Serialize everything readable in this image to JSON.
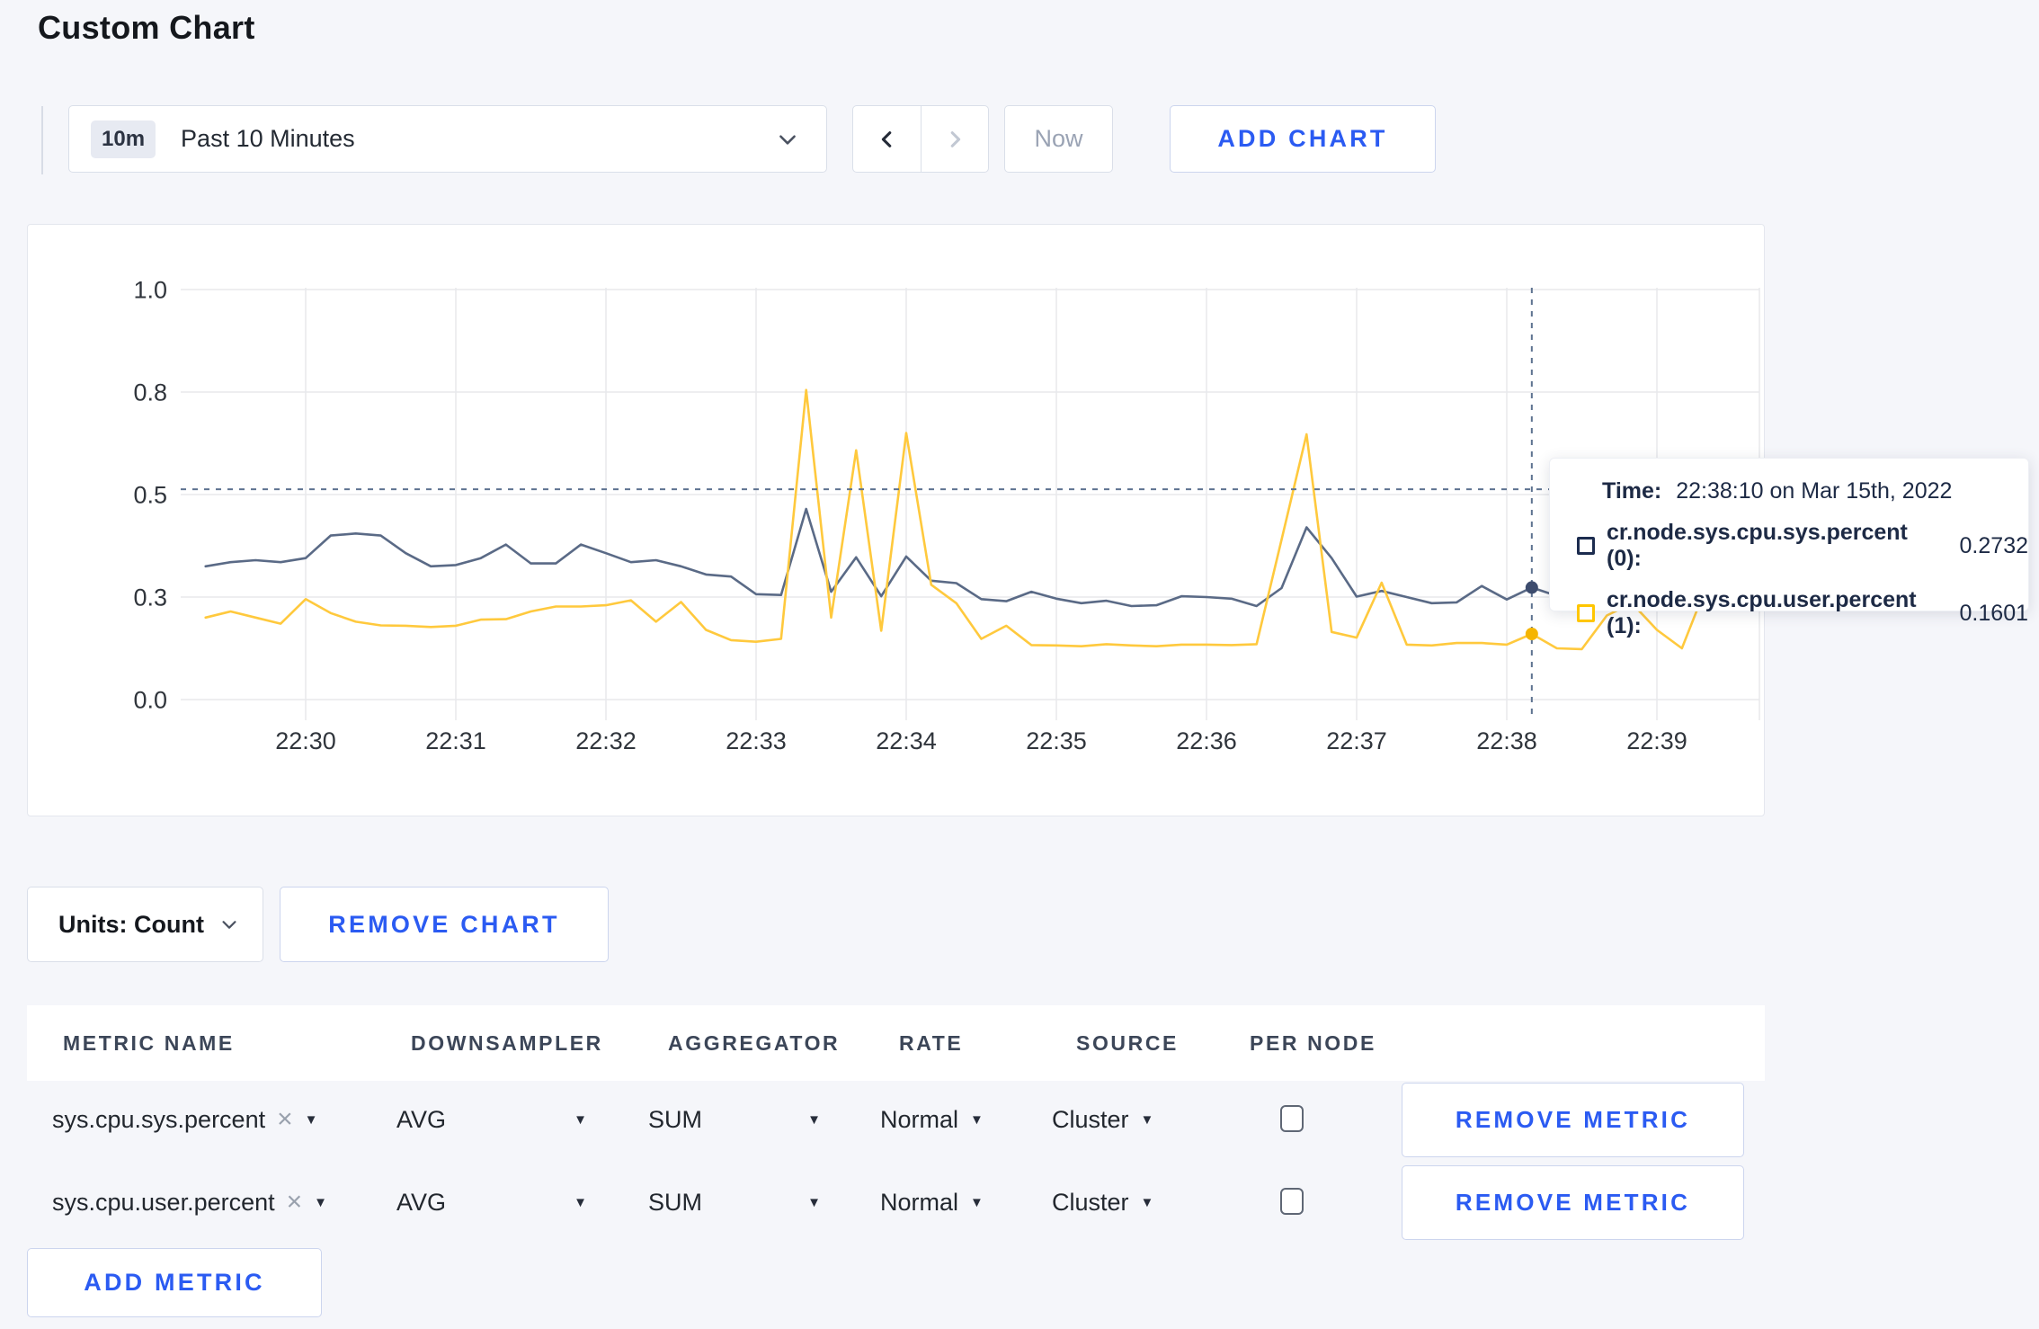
{
  "page": {
    "title": "Custom Chart"
  },
  "toolbar": {
    "time_badge": "10m",
    "time_label": "Past 10 Minutes",
    "now_label": "Now",
    "add_chart_label": "ADD CHART"
  },
  "chart_data": {
    "type": "line",
    "title": "",
    "xlabel": "",
    "ylabel": "",
    "ylim": [
      0,
      1
    ],
    "grid": true,
    "legend_position": "tooltip",
    "y_ticks": [
      {
        "v": 0.0,
        "label": "0.0"
      },
      {
        "v": 0.25,
        "label": "0.3"
      },
      {
        "v": 0.5,
        "label": "0.5"
      },
      {
        "v": 0.75,
        "label": "0.8"
      },
      {
        "v": 1.0,
        "label": "1.0"
      }
    ],
    "x_ticks": [
      "22:30",
      "22:31",
      "22:32",
      "22:33",
      "22:34",
      "22:35",
      "22:36",
      "22:37",
      "22:38",
      "22:39"
    ],
    "start_time": "22:29:20",
    "step_seconds": 10,
    "crosshair": {
      "time": "22:38:10",
      "hline_value": 0.513
    },
    "series": [
      {
        "name": "cr.node.sys.cpu.sys.percent",
        "color": "#5a6a86",
        "marker_color": "#3d4c6e",
        "values": [
          0.325,
          0.335,
          0.34,
          0.335,
          0.345,
          0.4,
          0.405,
          0.4,
          0.357,
          0.325,
          0.328,
          0.345,
          0.378,
          0.332,
          0.332,
          0.378,
          0.357,
          0.335,
          0.34,
          0.325,
          0.305,
          0.3,
          0.257,
          0.255,
          0.465,
          0.263,
          0.347,
          0.252,
          0.349,
          0.29,
          0.284,
          0.245,
          0.24,
          0.263,
          0.246,
          0.235,
          0.241,
          0.228,
          0.23,
          0.252,
          0.25,
          0.246,
          0.228,
          0.272,
          0.42,
          0.345,
          0.251,
          0.265,
          0.25,
          0.235,
          0.237,
          0.277,
          0.244,
          0.2732,
          0.253,
          0.245,
          0.26,
          0.3,
          0.295,
          0.29,
          0.3
        ]
      },
      {
        "name": "cr.node.sys.cpu.user.percent",
        "color": "#ffc93d",
        "marker_color": "#f5b500",
        "values": [
          0.2,
          0.215,
          0.2,
          0.185,
          0.245,
          0.211,
          0.19,
          0.181,
          0.18,
          0.177,
          0.18,
          0.195,
          0.196,
          0.215,
          0.227,
          0.227,
          0.23,
          0.242,
          0.19,
          0.238,
          0.17,
          0.145,
          0.141,
          0.148,
          0.755,
          0.2,
          0.608,
          0.168,
          0.65,
          0.28,
          0.235,
          0.148,
          0.18,
          0.133,
          0.132,
          0.13,
          0.135,
          0.132,
          0.13,
          0.134,
          0.134,
          0.133,
          0.135,
          0.39,
          0.647,
          0.165,
          0.151,
          0.285,
          0.134,
          0.132,
          0.138,
          0.138,
          0.134,
          0.1601,
          0.125,
          0.123,
          0.205,
          0.235,
          0.17,
          0.125,
          0.28
        ]
      }
    ]
  },
  "tooltip": {
    "time_label": "Time:",
    "time_value": "22:38:10 on Mar 15th, 2022",
    "rows": [
      {
        "name": "cr.node.sys.cpu.sys.percent (0):",
        "value": "0.2732",
        "color": "#1c2c4f"
      },
      {
        "name": "cr.node.sys.cpu.user.percent (1):",
        "value": "0.1601",
        "color": "#ffc600"
      }
    ]
  },
  "chart_controls": {
    "units_label": "Units: Count",
    "remove_chart_label": "REMOVE CHART"
  },
  "metrics_table": {
    "headers": [
      "METRIC NAME",
      "DOWNSAMPLER",
      "AGGREGATOR",
      "RATE",
      "SOURCE",
      "PER NODE"
    ],
    "rows": [
      {
        "metric": "sys.cpu.sys.percent",
        "downsampler": "AVG",
        "aggregator": "SUM",
        "rate": "Normal",
        "source": "Cluster",
        "per_node": false,
        "remove_label": "REMOVE METRIC"
      },
      {
        "metric": "sys.cpu.user.percent",
        "downsampler": "AVG",
        "aggregator": "SUM",
        "rate": "Normal",
        "source": "Cluster",
        "per_node": false,
        "remove_label": "REMOVE METRIC"
      }
    ],
    "add_metric_label": "ADD METRIC"
  }
}
